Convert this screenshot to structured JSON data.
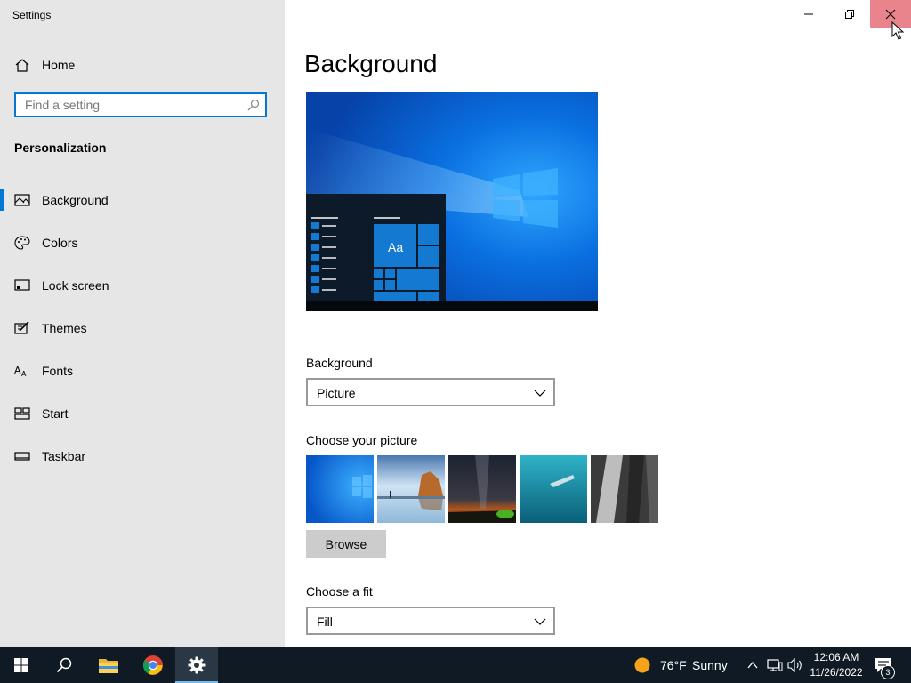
{
  "window": {
    "title": "Settings",
    "controls": {
      "minimize": "minimize-icon",
      "restore": "restore-icon",
      "close": "close-icon"
    }
  },
  "sidebar": {
    "home_label": "Home",
    "search_placeholder": "Find a setting",
    "section_title": "Personalization",
    "items": [
      {
        "label": "Background",
        "icon": "picture-icon",
        "active": true
      },
      {
        "label": "Colors",
        "icon": "palette-icon"
      },
      {
        "label": "Lock screen",
        "icon": "lock-screen-icon"
      },
      {
        "label": "Themes",
        "icon": "themes-icon"
      },
      {
        "label": "Fonts",
        "icon": "fonts-icon"
      },
      {
        "label": "Start",
        "icon": "start-icon"
      },
      {
        "label": "Taskbar",
        "icon": "taskbar-icon"
      }
    ]
  },
  "main": {
    "title": "Background",
    "preview": {
      "sample_text": "Aa"
    },
    "background_label": "Background",
    "background_value": "Picture",
    "choose_picture_label": "Choose your picture",
    "pictures": [
      "windows-blue-wallpaper",
      "beach-rock-wallpaper",
      "night-sky-wallpaper",
      "underwater-wallpaper",
      "waterfall-wallpaper"
    ],
    "browse_label": "Browse",
    "choose_fit_label": "Choose a fit",
    "fit_value": "Fill"
  },
  "taskbar": {
    "weather_temp": "76°F",
    "weather_text": "Sunny",
    "time": "12:06 AM",
    "date": "11/26/2022",
    "notification_count": "3"
  },
  "colors": {
    "accent": "#0078d4",
    "sidebar_bg": "#e6e6e6",
    "taskbar_bg": "#101a24",
    "close_hover": "#e9848c"
  }
}
